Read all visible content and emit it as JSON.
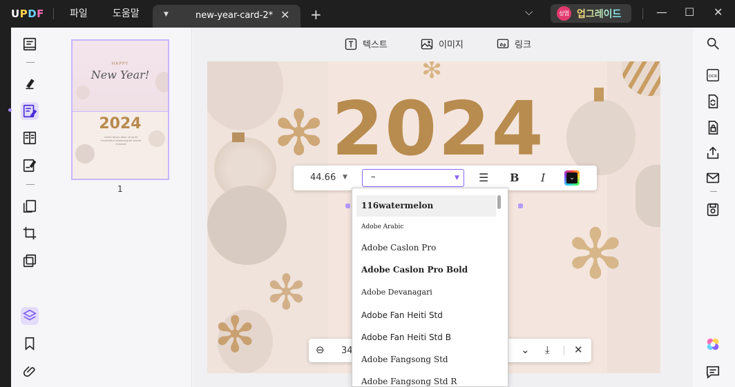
{
  "titlebar": {
    "logo": [
      "U",
      "P",
      "D",
      "F"
    ],
    "menu_file": "파일",
    "menu_help": "도움말",
    "tab_name": "new-year-card-2*",
    "upgrade_avatar": "성엽",
    "upgrade_label": "업그레이드"
  },
  "thumbnail": {
    "page_number": "1",
    "happy": "HAPPY",
    "newyear": "New Year!",
    "year": "2024",
    "body": "Lorem ipsum dolor sit amet consectetur adipiscing elit sed do eiusmod"
  },
  "edit_toolbar": {
    "text": "텍스트",
    "image": "이미지",
    "link": "링크"
  },
  "canvas": {
    "year": "2024"
  },
  "format_bar": {
    "font_size": "44.66",
    "font_value": "–"
  },
  "font_list": [
    "116watermelon",
    "Adobe Arabic",
    "Adobe Caslon Pro",
    "Adobe Caslon Pro Bold",
    "Adobe Devanagari",
    "Adobe Fan Heiti Std",
    "Adobe Fan Heiti Std B",
    "Adobe Fangsong Std",
    "Adobe Fangsong Std R"
  ],
  "zoom": {
    "value": "34%"
  },
  "colors": {
    "accent": "#8a63ff",
    "gold": "#c89a55"
  }
}
